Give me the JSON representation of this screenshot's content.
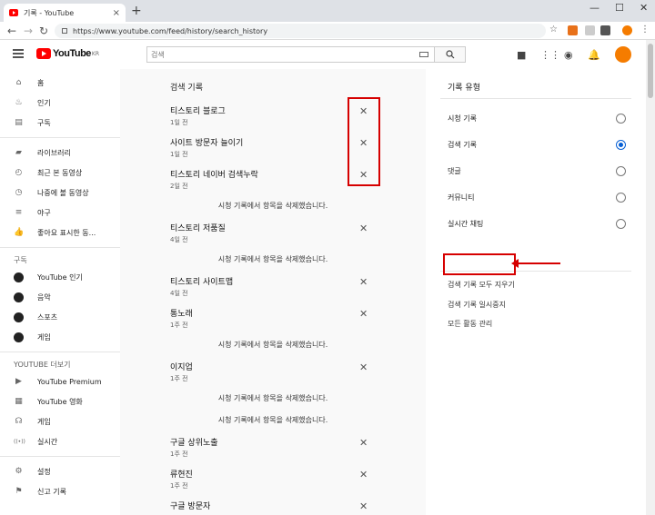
{
  "browser": {
    "tab_title": "기록 - YouTube",
    "tab_close": "×",
    "new_tab": "+",
    "url": "https://www.youtube.com/feed/history/search_history",
    "window_min": "—",
    "window_max": "☐",
    "window_close": "✕"
  },
  "masthead": {
    "logo_text": "YouTube",
    "logo_region": "KR",
    "search_placeholder": "검색"
  },
  "sidebar": {
    "primary": [
      {
        "icon": "home-icon",
        "glyph": "⌂",
        "label": "홈"
      },
      {
        "icon": "trending-icon",
        "glyph": "♨",
        "label": "인기"
      },
      {
        "icon": "subscriptions-icon",
        "glyph": "▤",
        "label": "구독"
      }
    ],
    "library": [
      {
        "icon": "library-icon",
        "glyph": "▰",
        "label": "라이브러리"
      },
      {
        "icon": "history-icon",
        "glyph": "◴",
        "label": "최근 본 동영상"
      },
      {
        "icon": "watch-later-icon",
        "glyph": "◷",
        "label": "나중에 볼 동영상"
      },
      {
        "icon": "playlist-icon",
        "glyph": "≡",
        "label": "야구"
      },
      {
        "icon": "like-icon",
        "glyph": "👍",
        "label": "좋아요 표시한 동..."
      }
    ],
    "subscriptions_header": "구독",
    "subscriptions": [
      {
        "icon": "channel-youtube-popular-icon",
        "label": "YouTube 인기"
      },
      {
        "icon": "channel-music-icon",
        "label": "음악"
      },
      {
        "icon": "channel-sports-icon",
        "label": "스포츠"
      },
      {
        "icon": "channel-gaming-icon",
        "label": "게임"
      }
    ],
    "more_header": "YOUTUBE 더보기",
    "more": [
      {
        "icon": "youtube-premium-icon",
        "glyph": "▶",
        "label": "YouTube Premium"
      },
      {
        "icon": "youtube-movies-icon",
        "glyph": "▦",
        "label": "YouTube 영화"
      },
      {
        "icon": "gaming-icon",
        "glyph": "☊",
        "label": "게임"
      },
      {
        "icon": "live-icon",
        "glyph": "((•))",
        "label": "실시간"
      }
    ],
    "bottom": [
      {
        "icon": "settings-icon",
        "glyph": "⚙",
        "label": "설정"
      },
      {
        "icon": "flag-icon",
        "glyph": "⚑",
        "label": "신고 기록"
      }
    ]
  },
  "main": {
    "title": "검색 기록",
    "remove_glyph": "✕",
    "notice_text": "시청 기록에서 항목을 삭제했습니다.",
    "items": [
      {
        "type": "query",
        "query": "티스토리 블로그",
        "when": "1일 전"
      },
      {
        "type": "query",
        "query": "사이트 방문자 늘이기",
        "when": "1일 전"
      },
      {
        "type": "query",
        "query": "티스토리 네이버 검색누락",
        "when": "2일 전"
      },
      {
        "type": "notice"
      },
      {
        "type": "query",
        "query": "티스토리 저품질",
        "when": "4일 전"
      },
      {
        "type": "notice"
      },
      {
        "type": "query",
        "query": "티스토리 사이트맵",
        "when": "4일 전"
      },
      {
        "type": "query",
        "query": "통노래",
        "when": "1주 전"
      },
      {
        "type": "notice"
      },
      {
        "type": "query",
        "query": "이지업",
        "when": "1주 전"
      },
      {
        "type": "notice"
      },
      {
        "type": "notice"
      },
      {
        "type": "query",
        "query": "구글 상위노출",
        "when": "1주 전"
      },
      {
        "type": "query",
        "query": "류현진",
        "when": "1주 전"
      },
      {
        "type": "query",
        "query": "구글 방문자",
        "when": ""
      }
    ]
  },
  "right": {
    "title": "기록 유형",
    "options": [
      {
        "label": "시청 기록",
        "selected": false
      },
      {
        "label": "검색 기록",
        "selected": true
      },
      {
        "label": "댓글",
        "selected": false
      },
      {
        "label": "커뮤니티",
        "selected": false
      },
      {
        "label": "실시간 채팅",
        "selected": false
      }
    ],
    "clear_all": "검색 기록 모두 지우기",
    "pause": "검색 기록 일시중지",
    "manage": "모든 활동 관리"
  },
  "colors": {
    "youtube_red": "#ff0000",
    "annotation_red": "#d60000",
    "radio_blue": "#065fd4"
  }
}
